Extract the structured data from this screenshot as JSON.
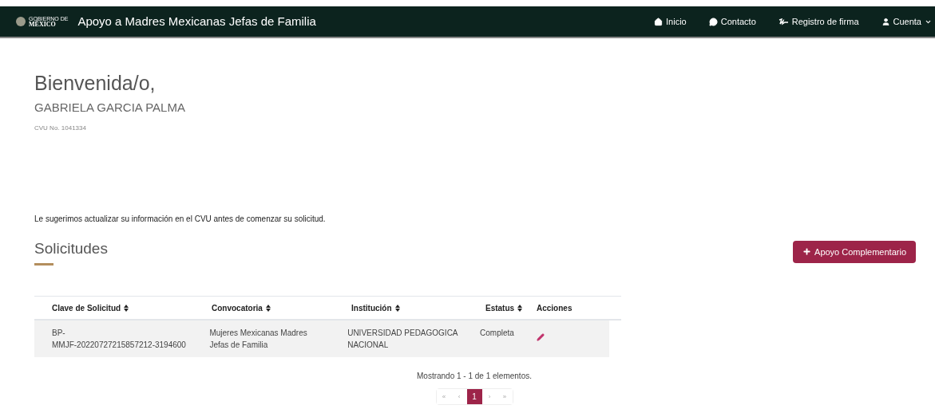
{
  "navbar": {
    "logo": {
      "top": "GOBIERNO DE",
      "bottom": "MÉXICO"
    },
    "title": "Apoyo a Madres Mexicanas Jefas de Familia",
    "links": [
      {
        "kind": "home",
        "label": "Inicio",
        "dropdown": false
      },
      {
        "kind": "chat",
        "label": "Contacto",
        "dropdown": false
      },
      {
        "kind": "signature",
        "label": "Registro de firma",
        "dropdown": false
      },
      {
        "kind": "user",
        "label": "Cuenta",
        "dropdown": true
      }
    ]
  },
  "welcome": {
    "greeting": "Bienvenida/o,",
    "name": "GABRIELA GARCIA PALMA",
    "cvu": "CVU No. 1041334"
  },
  "notice": "Le sugerimos actualizar su información en el CVU antes de comenzar su solicitud.",
  "section": {
    "title": "Solicitudes",
    "button": "Apoyo Complementario"
  },
  "table": {
    "columns": [
      {
        "label": "Clave de Solicitud",
        "sortable": true
      },
      {
        "label": "Convocatoria",
        "sortable": true
      },
      {
        "label": "Institución",
        "sortable": true
      },
      {
        "label": "Estatus",
        "sortable": true
      },
      {
        "label": "Acciones",
        "sortable": false
      }
    ],
    "rows": [
      {
        "clave": "BP-\nMMJF-20220727215857212-3194600",
        "convocatoria": "Mujeres Mexicanas Madres\nJefas de Familia",
        "institucion": "UNIVERSIDAD PEDAGOGICA\nNACIONAL",
        "estatus": "Completa"
      }
    ]
  },
  "summary": "Mostrando 1 - 1 de 1 elementos.",
  "pagination": [
    {
      "label": "«",
      "selected": false
    },
    {
      "label": "‹",
      "selected": false
    },
    {
      "label": "1",
      "selected": true
    },
    {
      "label": "›",
      "selected": false
    },
    {
      "label": "»",
      "selected": false
    }
  ]
}
